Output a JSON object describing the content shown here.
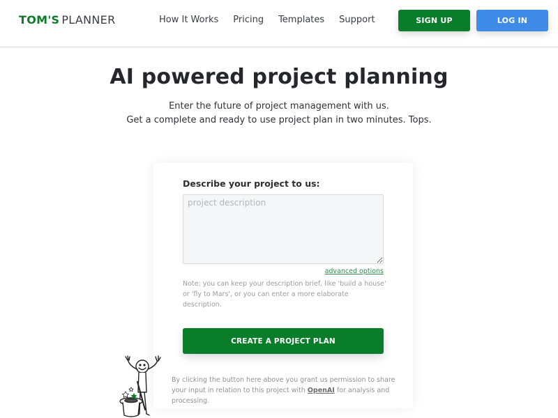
{
  "header": {
    "logo_brand": "TOM'S",
    "logo_product": "PLANNER",
    "nav": [
      {
        "label": "How It Works"
      },
      {
        "label": "Pricing"
      },
      {
        "label": "Templates"
      },
      {
        "label": "Support"
      }
    ],
    "signup_label": "SIGN UP",
    "login_label": "LOG IN"
  },
  "hero": {
    "title": "AI powered project planning",
    "subtitle_line1": "Enter the future of project management with us.",
    "subtitle_line2": "Get a complete and ready to use project plan in two minutes. Tops."
  },
  "form": {
    "label": "Describe your project to us:",
    "description_value": "",
    "description_placeholder": "project description",
    "advanced_options_label": "advanced options",
    "note": "Note: you can keep your description brief, like 'build a house' or 'fly to Mars', or you can enter a more elaborate description.",
    "create_button_label": "CREATE A PROJECT PLAN",
    "consent_before": "By clicking the button here above you grant us permission to share your input in relation to this project with ",
    "consent_link": "OpenAI",
    "consent_after": " for analysis and processing."
  },
  "illustration": {
    "icon": "magician-stick-figure-icon"
  },
  "colors": {
    "brand_green": "#0a7d2a",
    "login_blue": "#3f8ce8",
    "link_green": "#2f8a4a"
  }
}
